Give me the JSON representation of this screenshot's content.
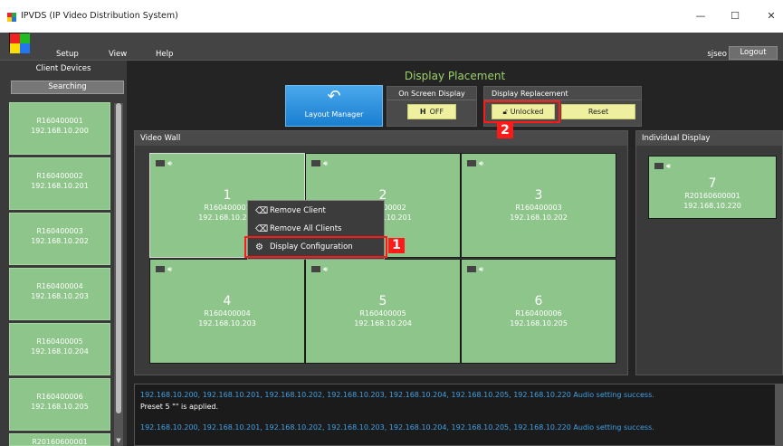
{
  "window": {
    "title": "IPVDS (IP Video Distribution System)",
    "minimize": "—",
    "maximize": "☐",
    "close": "✕"
  },
  "menu": {
    "setup": "Setup",
    "view": "View",
    "help": "Help",
    "user": "sjseo",
    "logout": "Logout"
  },
  "sidebar": {
    "title": "Client Devices",
    "search_button": "Searching",
    "clients": [
      {
        "id": "R160400001",
        "ip": "192.168.10.200"
      },
      {
        "id": "R160400002",
        "ip": "192.168.10.201"
      },
      {
        "id": "R160400003",
        "ip": "192.168.10.202"
      },
      {
        "id": "R160400004",
        "ip": "192.168.10.203"
      },
      {
        "id": "R160400005",
        "ip": "192.168.10.204"
      },
      {
        "id": "R160400006",
        "ip": "192.168.10.205"
      },
      {
        "id": "R20160600001",
        "ip": ""
      }
    ]
  },
  "header": {
    "title": "Display Placement",
    "layout_manager": "Layout Manager",
    "osd_title": "On Screen Display",
    "osd_value": "OFF",
    "replacement_title": "Display Replacement",
    "unlocked": "Unlocked",
    "reset": "Reset"
  },
  "video_wall": {
    "title": "Video Wall",
    "cells": [
      {
        "num": "1",
        "id": "R160400001",
        "ip": "192.168.10.200"
      },
      {
        "num": "2",
        "id": "R160400002",
        "ip": "192.168.10.201"
      },
      {
        "num": "3",
        "id": "R160400003",
        "ip": "192.168.10.202"
      },
      {
        "num": "4",
        "id": "R160400004",
        "ip": "192.168.10.203"
      },
      {
        "num": "5",
        "id": "R160400005",
        "ip": "192.168.10.204"
      },
      {
        "num": "6",
        "id": "R160400006",
        "ip": "192.168.10.205"
      }
    ]
  },
  "individual": {
    "title": "Individual Display",
    "cell": {
      "num": "7",
      "id": "R20160600001",
      "ip": "192.168.10.220"
    }
  },
  "context_menu": {
    "remove_client": "Remove Client",
    "remove_all": "Remove All Clients",
    "display_config": "Display Configuration"
  },
  "annotations": {
    "tag1": "1",
    "tag2": "2"
  },
  "log": {
    "line1": "192.168.10.200, 192.168.10.201, 192.168.10.202, 192.168.10.203, 192.168.10.204, 192.168.10.205, 192.168.10.220 Audio setting success.",
    "line2": "Preset 5 \"\" is applied.",
    "line3": "192.168.10.200, 192.168.10.201, 192.168.10.202, 192.168.10.203, 192.168.10.204, 192.168.10.205, 192.168.10.220 Audio setting success."
  },
  "colors": {
    "accent": "#1a7fd1",
    "cell": "#8ec58b",
    "highlight": "#ff1a1a"
  }
}
